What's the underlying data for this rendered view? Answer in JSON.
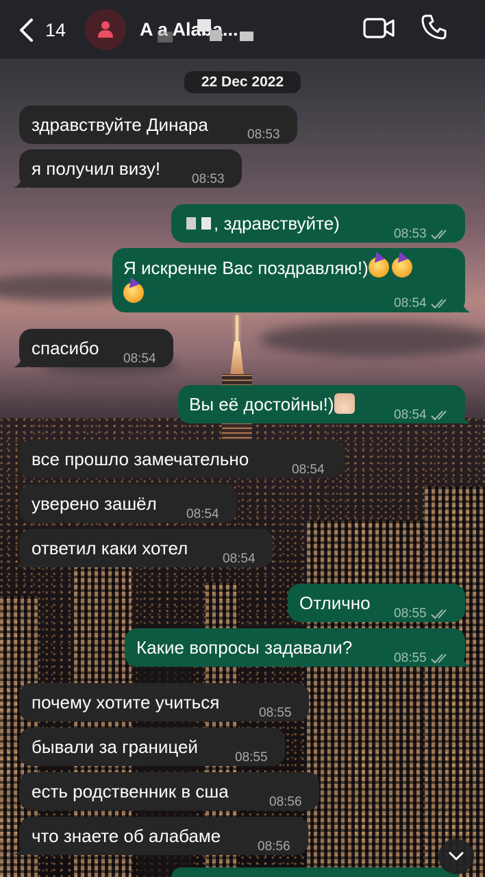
{
  "header": {
    "back_count": "14",
    "contact_name": "A          a Alaba...",
    "icons": {
      "back": "chevron-left-icon",
      "avatar": "person-icon",
      "video": "video-camera-icon",
      "phone": "phone-icon"
    }
  },
  "date_separator": "22 Dec 2022",
  "messages": [
    {
      "dir": "in",
      "text": "здравствуйте Динара",
      "time": "08:53"
    },
    {
      "dir": "in",
      "text": "я получил визу!",
      "time": "08:53"
    },
    {
      "dir": "out",
      "text": ", здравствуйте)",
      "time": "08:53",
      "read": true
    },
    {
      "dir": "out",
      "text": "Я искренне Вас поздравляю!)",
      "time": "08:54",
      "read": true
    },
    {
      "dir": "in",
      "text": "спасибо",
      "time": "08:54"
    },
    {
      "dir": "out",
      "text": "Вы её достойны!)",
      "time": "08:54",
      "read": true
    },
    {
      "dir": "in",
      "text": "все прошло замечательно",
      "time": "08:54"
    },
    {
      "dir": "in",
      "text": "уверено зашёл",
      "time": "08:54"
    },
    {
      "dir": "in",
      "text": "ответил каки хотел",
      "time": "08:54"
    },
    {
      "dir": "out",
      "text": "Отлично",
      "time": "08:55",
      "read": true
    },
    {
      "dir": "out",
      "text": "Какие вопросы задавали?",
      "time": "08:55",
      "read": true
    },
    {
      "dir": "in",
      "text": "почему хотите учиться",
      "time": "08:55"
    },
    {
      "dir": "in",
      "text": "бывали за границей",
      "time": "08:55"
    },
    {
      "dir": "in",
      "text": "есть родственник в сша",
      "time": "08:56"
    },
    {
      "dir": "in",
      "text": "что знаете об алабаме",
      "time": "08:56"
    }
  ],
  "colors": {
    "incoming_bubble": "#262627",
    "outgoing_bubble": "#0d5a42",
    "header_bg": "#212428"
  },
  "scroll_button_icon": "chevron-down-icon"
}
